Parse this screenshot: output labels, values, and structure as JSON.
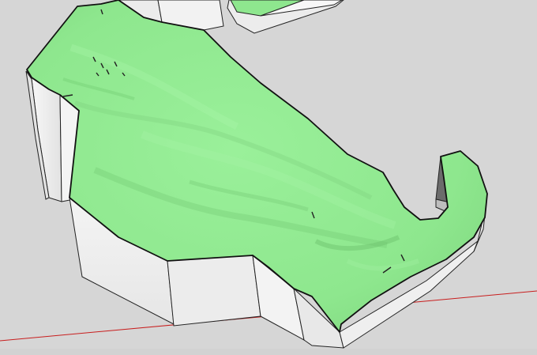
{
  "scene": {
    "terrain_color": "#8ee78e",
    "wall_color": "#ececec",
    "wall_shadow_color": "#f7f7f7",
    "edge_color": "#111111",
    "background_color": "#d6d6d6",
    "red_axis_color": "#c81e1e",
    "dark_face_color": "#6b6b6b"
  }
}
